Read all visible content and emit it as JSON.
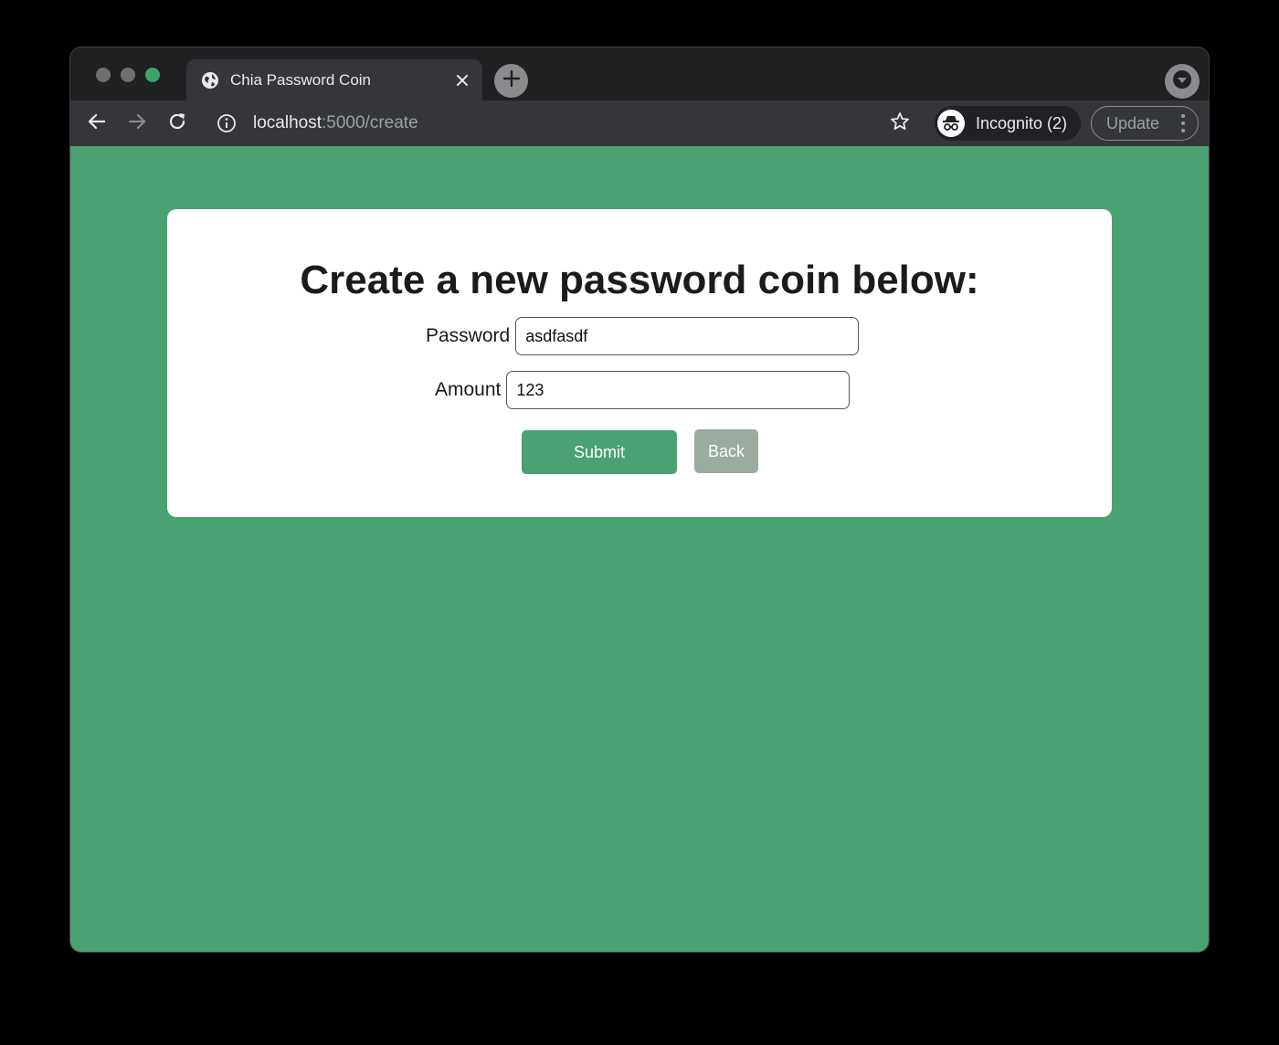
{
  "browser": {
    "tab_title": "Chia Password Coin",
    "url_host": "localhost",
    "url_path": ":5000/create",
    "incognito_label": "Incognito (2)",
    "update_label": "Update"
  },
  "page": {
    "heading": "Create a new password coin below:",
    "form": {
      "password_label": "Password",
      "password_value": "asdfasdf",
      "amount_label": "Amount",
      "amount_value": "123",
      "submit_label": "Submit",
      "back_label": "Back"
    }
  },
  "colors": {
    "page_background": "#4aa172",
    "submit_button": "#4aa172",
    "back_button": "#9aab9f",
    "card_background": "#ffffff"
  },
  "icons": {
    "tab_favicon": "globe-icon",
    "tab_close": "close-icon",
    "new_tab": "plus-icon",
    "profile_menu": "chevron-down-icon",
    "back": "arrow-left-icon",
    "forward": "arrow-right-icon",
    "reload": "reload-icon",
    "site_info": "info-icon",
    "bookmark": "star-icon",
    "incognito": "incognito-icon",
    "menu": "kebab-menu-icon"
  }
}
